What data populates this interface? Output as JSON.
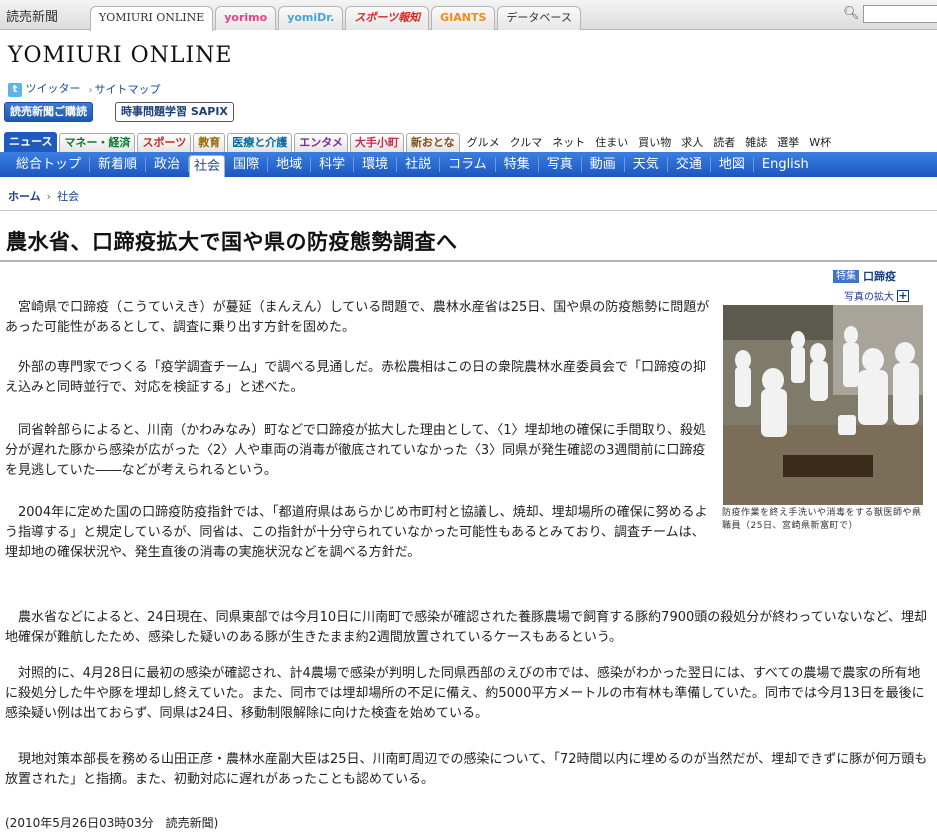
{
  "network": {
    "brand_jp": "読売新聞",
    "tabs": [
      {
        "label": "YOMIURI ONLINE",
        "style": "active"
      },
      {
        "label": "yorimo",
        "style": "yorimo"
      },
      {
        "label": "yomiDr.",
        "style": "yomidr"
      },
      {
        "label": "スポーツ報知",
        "style": "sports"
      },
      {
        "label": "GIANTS",
        "style": "giants"
      },
      {
        "label": "データベース",
        "style": "db"
      }
    ],
    "search_icon": "search-icon"
  },
  "header": {
    "logo": "YOMIURI ONLINE",
    "twitter": "ツイッター",
    "sitemap": "サイトマップ",
    "subscribe": "読売新聞ご購読",
    "sapix": "時事問題学習 SAPIX"
  },
  "genre": {
    "tabs": [
      "ニュース",
      "マネー・経済",
      "スポーツ",
      "教育",
      "医療と介護",
      "エンタメ",
      "大手小町",
      "新おとな"
    ],
    "links": [
      "グルメ",
      "クルマ",
      "ネット",
      "住まい",
      "買い物",
      "求人",
      "読者",
      "雑誌",
      "選挙",
      "W杯"
    ]
  },
  "categories": [
    "総合トップ",
    "新着順",
    "政治",
    "社会",
    "国際",
    "地域",
    "科学",
    "環境",
    "社説",
    "コラム",
    "特集",
    "写真",
    "動画",
    "天気",
    "交通",
    "地図",
    "English"
  ],
  "breadcrumb": {
    "home": "ホーム",
    "current": "社会"
  },
  "article": {
    "title": "農水省、口蹄疫拡大で国や県の防疫態勢調査へ",
    "related_tag": "特集",
    "related_topic": "口蹄疫",
    "enlarge": "写真の拡大",
    "caption": "防疫作業を終え手洗いや消毒をする獣医師や県職員（25日、宮崎県新富町で）",
    "paragraphs": [
      "　宮崎県で口蹄疫（こうていえき）が蔓延（まんえん）している問題で、農林水産省は25日、国や県の防疫態勢に問題があった可能性があるとして、調査に乗り出す方針を固めた。",
      "　外部の専門家でつくる「疫学調査チーム」で調べる見通しだ。赤松農相はこの日の衆院農林水産委員会で「口蹄疫の抑え込みと同時並行で、対応を検証する」と述べた。",
      "　同省幹部らによると、川南（かわみなみ）町などで口蹄疫が拡大した理由として、〈1〉埋却地の確保に手間取り、殺処分が遅れた豚から感染が広がった〈2〉人や車両の消毒が徹底されていなかった〈3〉同県が発生確認の3週間前に口蹄疫を見逃していた――などが考えられるという。",
      "　2004年に定めた国の口蹄疫防疫指針では、「都道府県はあらかじめ市町村と協議し、焼却、埋却場所の確保に努めるよう指導する」と規定しているが、同省は、この指針が十分守られていなかった可能性もあるとみており、調査チームは、埋却地の確保状況や、発生直後の消毒の実施状況などを調べる方針だ。",
      "　農水省などによると、24日現在、同県東部では今月10日に川南町で感染が確認された養豚農場で飼育する豚約7900頭の殺処分が終わっていないなど、埋却地確保が難航したため、感染した疑いのある豚が生きたまま約2週間放置されているケースもあるという。",
      "　対照的に、4月28日に最初の感染が確認され、計4農場で感染が判明した同県西部のえびの市では、感染がわかった翌日には、すべての農場で農家の所有地に殺処分した牛や豚を埋却し終えていた。また、同市では埋却場所の不足に備え、約5000平方メートルの市有林も準備していた。同市では今月13日を最後に感染疑い例は出ておらず、同県は24日、移動制限解除に向けた検査を始めている。",
      "　現地対策本部長を務める山田正彦・農林水産副大臣は25日、川南町周辺での感染について、「72時間以内に埋めるのが当然だが、埋却できずに豚が何万頭も放置された」と指摘。また、初動対応に遅れがあったことも認めている。"
    ],
    "dateline": "(2010年5月26日03時03分　読売新聞)"
  }
}
